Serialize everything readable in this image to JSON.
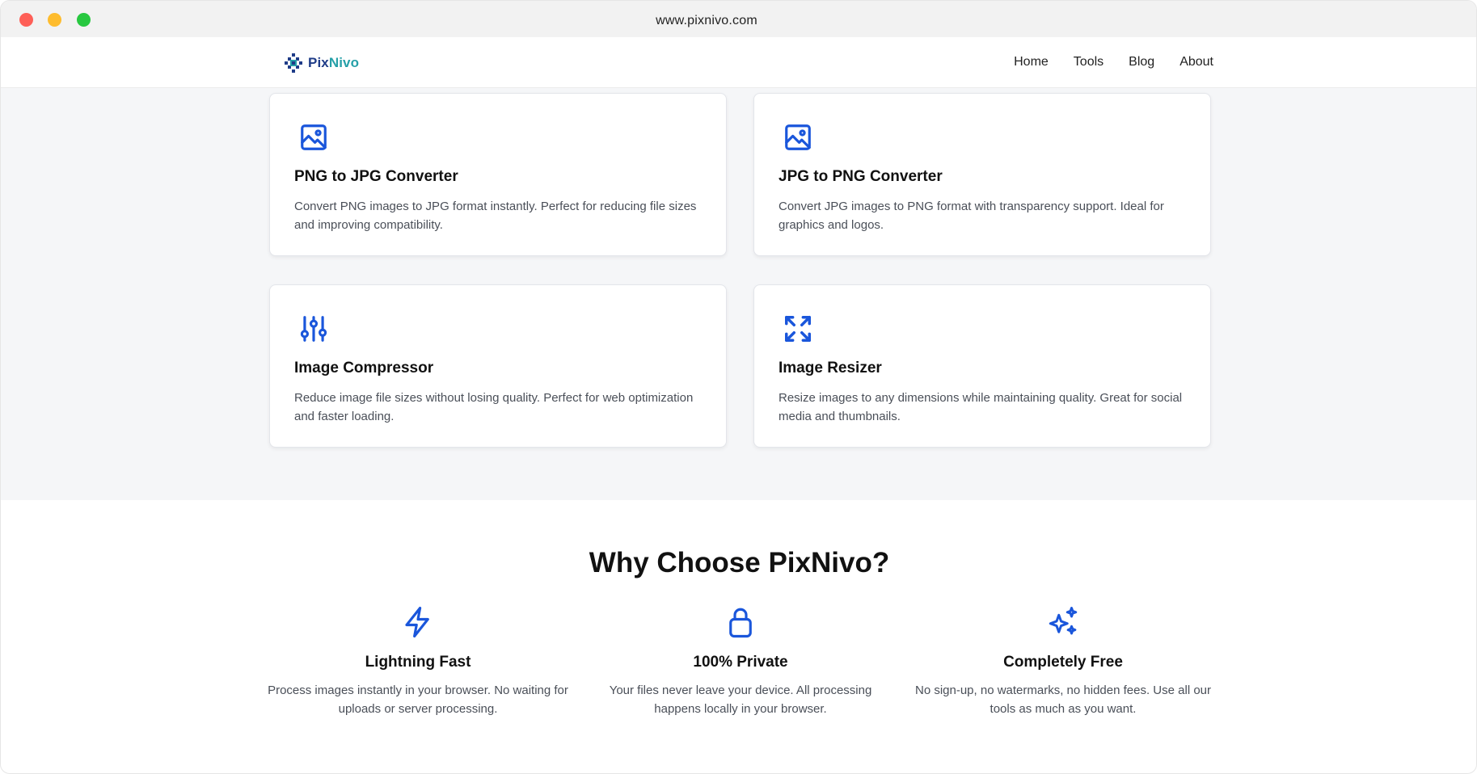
{
  "browser": {
    "url": "www.pixnivo.com"
  },
  "nav": {
    "logo_part1": "Pix",
    "logo_part2": "Nivo",
    "links": [
      "Home",
      "Tools",
      "Blog",
      "About"
    ]
  },
  "tools": [
    {
      "icon": "image-icon",
      "title": "PNG to JPG Converter",
      "description": "Convert PNG images to JPG format instantly. Perfect for reducing file sizes and improving compatibility."
    },
    {
      "icon": "image-icon",
      "title": "JPG to PNG Converter",
      "description": "Convert JPG images to PNG format with transparency support. Ideal for graphics and logos."
    },
    {
      "icon": "sliders-icon",
      "title": "Image Compressor",
      "description": "Reduce image file sizes without losing quality. Perfect for web optimization and faster loading."
    },
    {
      "icon": "expand-icon",
      "title": "Image Resizer",
      "description": "Resize images to any dimensions while maintaining quality. Great for social media and thumbnails."
    }
  ],
  "why": {
    "title": "Why Choose PixNivo?",
    "features": [
      {
        "icon": "lightning-icon",
        "title": "Lightning Fast",
        "description": "Process images instantly in your browser. No waiting for uploads or server processing."
      },
      {
        "icon": "lock-icon",
        "title": "100% Private",
        "description": "Your files never leave your device. All processing happens locally in your browser."
      },
      {
        "icon": "sparkles-icon",
        "title": "Completely Free",
        "description": "No sign-up, no watermarks, no hidden fees. Use all our tools as much as you want."
      }
    ]
  },
  "colors": {
    "accent": "#1a56db",
    "section_bg": "#f5f6f8"
  }
}
